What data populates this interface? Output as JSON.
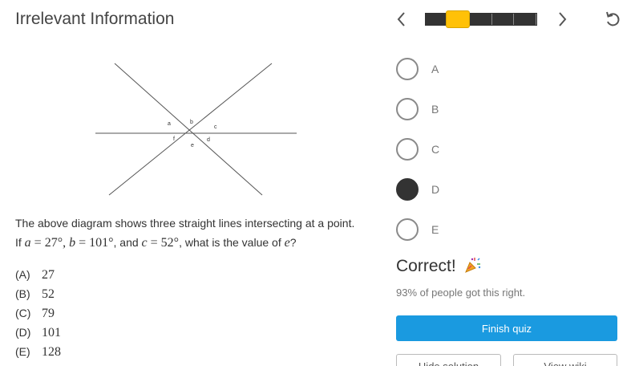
{
  "header": {
    "title": "Irrelevant Information",
    "prev_icon": "chevron-left-icon",
    "next_icon": "chevron-right-icon",
    "reset_icon": "reset-icon"
  },
  "progress": {
    "total_segments": 5,
    "current_index": 1,
    "accent_color": "#ffc107"
  },
  "diagram": {
    "labels": {
      "a": "a",
      "b": "b",
      "c": "c",
      "d": "d",
      "e": "e",
      "f": "f"
    }
  },
  "question": {
    "line1": "The above diagram shows three straight lines intersecting at a point.",
    "if_text": "If ",
    "a_var": "a",
    "a_eq": " = 27°",
    "b_var": "b",
    "b_eq": " = 101°",
    "and_text": ", and ",
    "c_var": "c",
    "c_eq": " = 52°",
    "ask_text": ", what is the value of ",
    "e_var": "e",
    "qmark": "?"
  },
  "choices": [
    {
      "label": "(A)",
      "value": "27"
    },
    {
      "label": "(B)",
      "value": "52"
    },
    {
      "label": "(C)",
      "value": "79"
    },
    {
      "label": "(D)",
      "value": "101"
    },
    {
      "label": "(E)",
      "value": "128"
    }
  ],
  "options": [
    {
      "label": "A",
      "selected": false
    },
    {
      "label": "B",
      "selected": false
    },
    {
      "label": "C",
      "selected": false
    },
    {
      "label": "D",
      "selected": true
    },
    {
      "label": "E",
      "selected": false
    }
  ],
  "result": {
    "status": "Correct!",
    "icon": "party-popper-icon",
    "stat": "93% of people got this right."
  },
  "buttons": {
    "finish": "Finish quiz",
    "hide_solution": "Hide solution",
    "view_wiki": "View wiki"
  },
  "colors": {
    "primary": "#1a9ae0",
    "selected": "#333333"
  }
}
